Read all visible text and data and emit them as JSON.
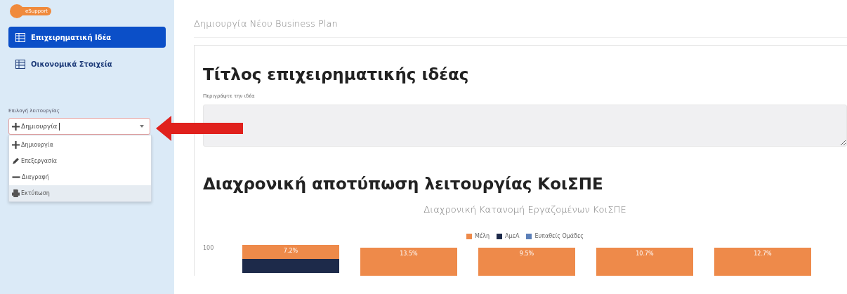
{
  "sidebar": {
    "logo": {
      "text": "eSupport"
    },
    "items": [
      {
        "label": "Επιχειρηματική Ιδέα",
        "selected": true
      },
      {
        "label": "Οικονομικά Στοιχεία",
        "selected": false
      }
    ],
    "mode_select": {
      "label": "Επιλογή λειτουργίας",
      "value": "Δημιουργία",
      "expanded": true,
      "options": [
        {
          "kind": "plus",
          "label": "Δημιουργία",
          "highlighted": false
        },
        {
          "kind": "pencil",
          "label": "Επεξεργασία",
          "highlighted": false
        },
        {
          "kind": "minus",
          "label": "Διαγραφή",
          "highlighted": false
        },
        {
          "kind": "print",
          "label": "Εκτύπωση",
          "highlighted": true
        }
      ]
    }
  },
  "page_title": "Δημιουργία Νέου Business Plan",
  "idea": {
    "heading": "Τίτλος επιχειρηματικής ιδέας",
    "field_label": "Περιγράψτε την ιδέα"
  },
  "timeline": {
    "heading": "Διαχρονική αποτύπωση λειτουργίας ΚοιΣΠΕ",
    "chart": {
      "title": "Διαχρονική Κατανομή Εργαζομένων ΚοιΣΠΕ",
      "y_tick": "100",
      "legend": [
        {
          "label": "Μέλη",
          "color": "#ee8a4a"
        },
        {
          "label": "ΑμεΑ",
          "color": "#1d2a4a"
        },
        {
          "label": "Ευπαθείς Ομάδες",
          "color": "#5b7fb8"
        }
      ],
      "bars": [
        {
          "label": "7.2%",
          "dark": true
        },
        {
          "label": "13.5%",
          "dark": false
        },
        {
          "label": "9.5%",
          "dark": false
        },
        {
          "label": "10.7%",
          "dark": false
        },
        {
          "label": "12.7%",
          "dark": false
        }
      ]
    }
  }
}
